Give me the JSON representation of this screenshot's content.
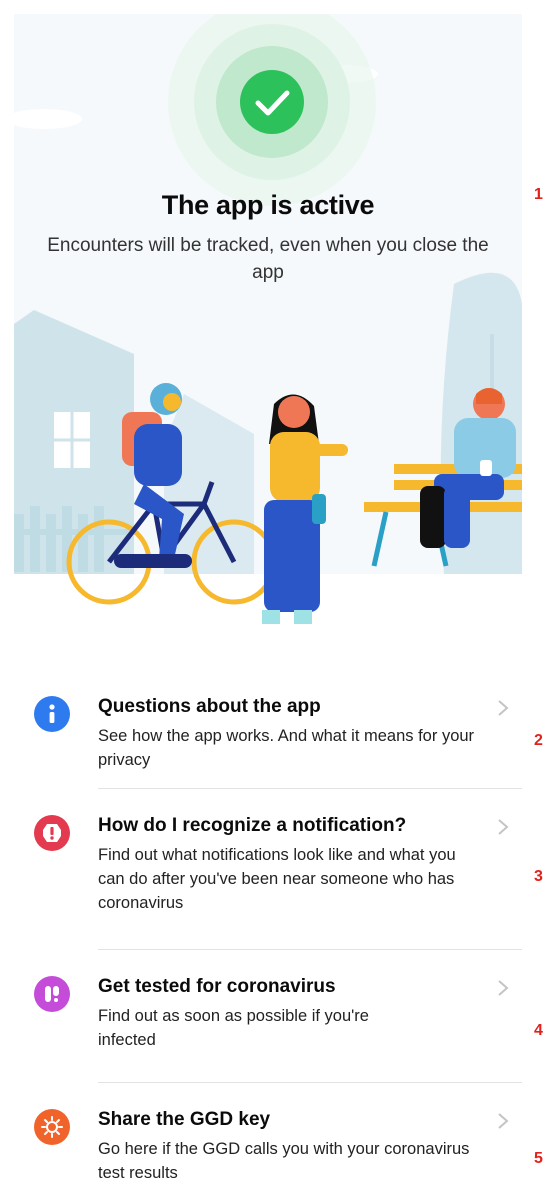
{
  "status": {
    "title": "The app is active",
    "subtitle": "Encounters will be tracked, even when you close the app"
  },
  "menu": [
    {
      "title": "Questions about the app",
      "desc": "See how the app works. And what it means for your privacy",
      "icon": "info-icon",
      "color": "#2e7bf0"
    },
    {
      "title": "How do I recognize a notification?",
      "desc": "Find out what notifications look like and what you can do after you've been near someone who has coronavirus",
      "icon": "alert-icon",
      "color": "#e43a4f"
    },
    {
      "title": "Get tested for coronavirus",
      "desc": "Find out as soon as possible if you're infected",
      "icon": "test-tube-icon",
      "color": "#c44cd9"
    },
    {
      "title": "Share the GGD key",
      "desc": "Go here if the GGD calls you with your coronavirus test results",
      "icon": "virus-icon",
      "color": "#f0642c"
    }
  ],
  "markers": [
    "1",
    "2",
    "3",
    "4",
    "5"
  ],
  "colors": {
    "active_green": "#2cc15a",
    "chevron": "#c4c4c7"
  }
}
